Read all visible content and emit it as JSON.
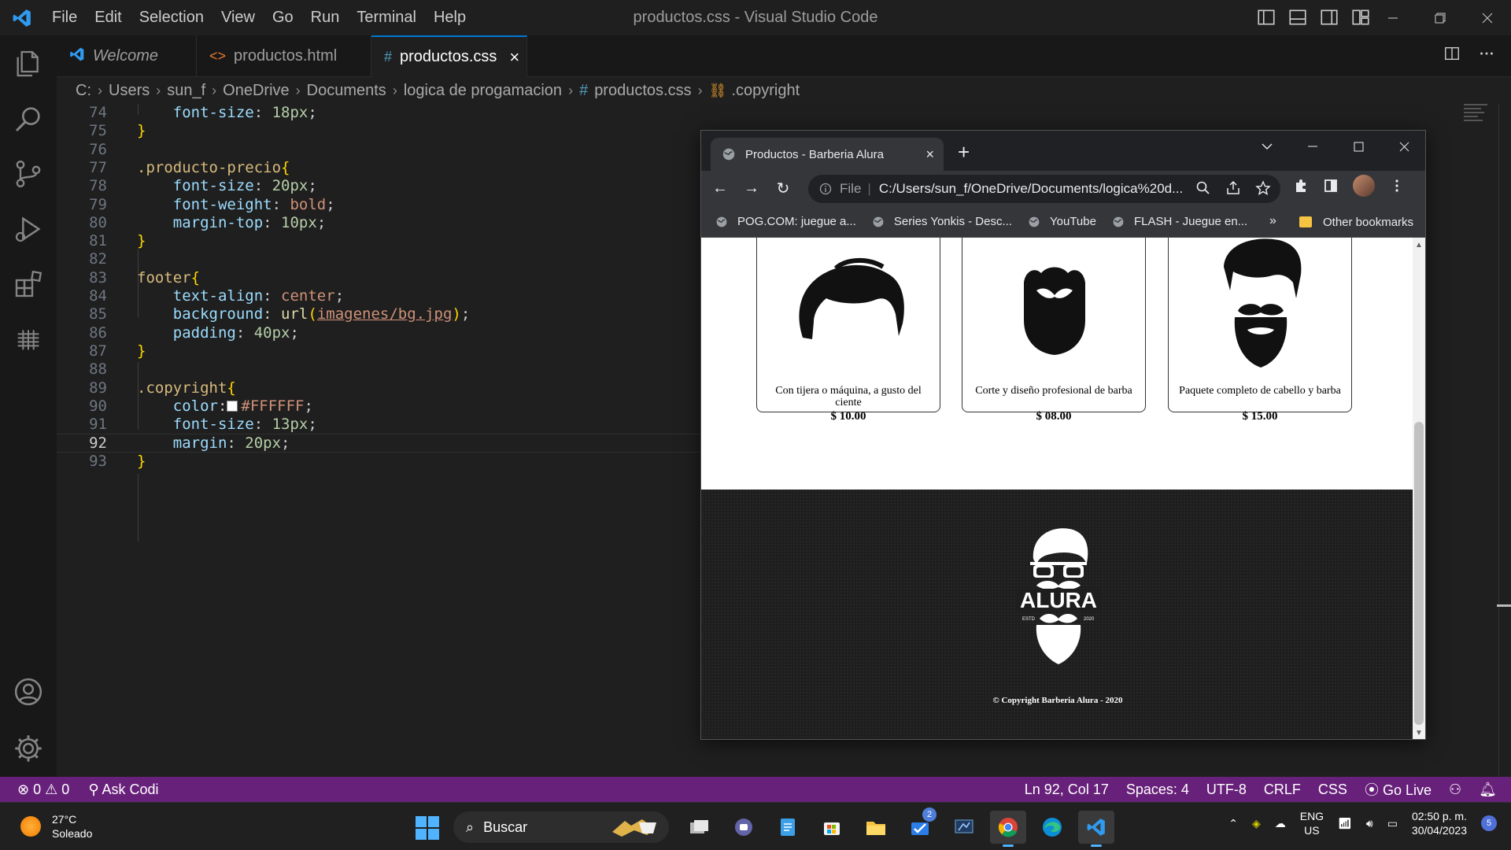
{
  "window": {
    "title": "productos.css - Visual Studio Code",
    "menu": [
      "File",
      "Edit",
      "Selection",
      "View",
      "Go",
      "Run",
      "Terminal",
      "Help"
    ]
  },
  "tabs": [
    {
      "label": "Welcome",
      "icon": "vscode-icon"
    },
    {
      "label": "productos.html",
      "icon": "html-icon"
    },
    {
      "label": "productos.css",
      "icon": "css-hash-icon",
      "active": true
    }
  ],
  "breadcrumb": [
    "C:",
    "Users",
    "sun_f",
    "OneDrive",
    "Documents",
    "logica de progamacion",
    "productos.css",
    ".copyright"
  ],
  "editor": {
    "lines": [
      {
        "n": "74",
        "code": [
          {
            "c": "prop",
            "t": "    font-size"
          },
          {
            "c": "punc",
            "t": ": "
          },
          {
            "c": "num",
            "t": "18px"
          },
          {
            "c": "punc",
            "t": ";"
          }
        ]
      },
      {
        "n": "75",
        "code": [
          {
            "c": "brace",
            "t": "}"
          }
        ]
      },
      {
        "n": "76",
        "code": []
      },
      {
        "n": "77",
        "code": [
          {
            "c": "sel",
            "t": ".producto-precio"
          },
          {
            "c": "brace",
            "t": "{"
          }
        ]
      },
      {
        "n": "78",
        "code": [
          {
            "c": "prop",
            "t": "    font-size"
          },
          {
            "c": "punc",
            "t": ": "
          },
          {
            "c": "num",
            "t": "20px"
          },
          {
            "c": "punc",
            "t": ";"
          }
        ]
      },
      {
        "n": "79",
        "code": [
          {
            "c": "prop",
            "t": "    font-weight"
          },
          {
            "c": "punc",
            "t": ": "
          },
          {
            "c": "val",
            "t": "bold"
          },
          {
            "c": "punc",
            "t": ";"
          }
        ]
      },
      {
        "n": "80",
        "code": [
          {
            "c": "prop",
            "t": "    margin-top"
          },
          {
            "c": "punc",
            "t": ": "
          },
          {
            "c": "num",
            "t": "10px"
          },
          {
            "c": "punc",
            "t": ";"
          }
        ]
      },
      {
        "n": "81",
        "code": [
          {
            "c": "brace",
            "t": "}"
          }
        ]
      },
      {
        "n": "82",
        "code": []
      },
      {
        "n": "83",
        "code": [
          {
            "c": "sel",
            "t": "footer"
          },
          {
            "c": "brace",
            "t": "{"
          }
        ]
      },
      {
        "n": "84",
        "code": [
          {
            "c": "prop",
            "t": "    text-align"
          },
          {
            "c": "punc",
            "t": ": "
          },
          {
            "c": "val",
            "t": "center"
          },
          {
            "c": "punc",
            "t": ";"
          }
        ]
      },
      {
        "n": "85",
        "code": [
          {
            "c": "prop",
            "t": "    background"
          },
          {
            "c": "punc",
            "t": ": "
          },
          {
            "c": "fn",
            "t": "url"
          },
          {
            "c": "brace",
            "t": "("
          },
          {
            "c": "url-arg",
            "t": "imagenes/bg.jpg"
          },
          {
            "c": "brace",
            "t": ")"
          },
          {
            "c": "punc",
            "t": ";"
          }
        ]
      },
      {
        "n": "86",
        "code": [
          {
            "c": "prop",
            "t": "    padding"
          },
          {
            "c": "punc",
            "t": ": "
          },
          {
            "c": "num",
            "t": "40px"
          },
          {
            "c": "punc",
            "t": ";"
          }
        ]
      },
      {
        "n": "87",
        "code": [
          {
            "c": "brace",
            "t": "}"
          }
        ]
      },
      {
        "n": "88",
        "code": []
      },
      {
        "n": "89",
        "code": [
          {
            "c": "sel",
            "t": ".copyright"
          },
          {
            "c": "brace",
            "t": "{"
          }
        ]
      },
      {
        "n": "90",
        "code": [
          {
            "c": "prop",
            "t": "    color"
          },
          {
            "c": "punc",
            "t": ":"
          },
          {
            "c": "swatch",
            "t": ""
          },
          {
            "c": "val",
            "t": "#FFFFFF"
          },
          {
            "c": "punc",
            "t": ";"
          }
        ]
      },
      {
        "n": "91",
        "code": [
          {
            "c": "prop",
            "t": "    font-size"
          },
          {
            "c": "punc",
            "t": ": "
          },
          {
            "c": "num",
            "t": "13px"
          },
          {
            "c": "punc",
            "t": ";"
          }
        ]
      },
      {
        "n": "92",
        "code": [
          {
            "c": "prop",
            "t": "    margin"
          },
          {
            "c": "punc",
            "t": ": "
          },
          {
            "c": "num",
            "t": "20px"
          },
          {
            "c": "punc",
            "t": ";"
          }
        ],
        "current": true
      },
      {
        "n": "93",
        "code": [
          {
            "c": "brace",
            "t": "}"
          }
        ]
      }
    ]
  },
  "browser": {
    "tab_title": "Productos - Barberia Alura",
    "address_scheme": "File",
    "address": "C:/Users/sun_f/OneDrive/Documents/logica%20d...",
    "bookmarks": [
      "POG.COM: juegue a...",
      "Series Yonkis - Desc...",
      "YouTube",
      "FLASH - Juegue en..."
    ],
    "bookmarks_more": "»",
    "other_bookmarks": "Other bookmarks",
    "products": [
      {
        "desc": "Con tijera o máquina, a gusto del ciente",
        "price": "$ 10.00",
        "img": "hair-icon"
      },
      {
        "desc": "Corte y diseño profesional de barba",
        "price": "$ 08.00",
        "img": "beard-icon"
      },
      {
        "desc": "Paquete completo de cabello y barba",
        "price": "$ 15.00",
        "img": "hair-beard-icon"
      }
    ],
    "footer": {
      "logo_text": "ALURA",
      "logo_left": "ESTD",
      "logo_right": "2020",
      "copyright": "© Copyright Barberia Alura - 2020"
    }
  },
  "statusbar": {
    "errors": "0",
    "warnings": "0",
    "codi": "Ask Codi",
    "position": "Ln 92, Col 17",
    "spaces": "Spaces: 4",
    "encoding": "UTF-8",
    "eol": "CRLF",
    "language": "CSS",
    "golive": "Go Live"
  },
  "taskbar": {
    "temp": "27°C",
    "condition": "Soleado",
    "search_placeholder": "Buscar",
    "store_badge": "2",
    "lang_top": "ENG",
    "lang_bottom": "US",
    "time": "02:50 p. m.",
    "date": "30/04/2023",
    "notifications": "5"
  }
}
